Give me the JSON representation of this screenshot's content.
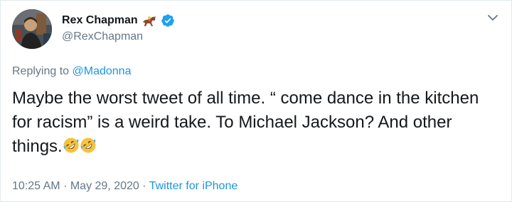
{
  "author": {
    "display_name": "Rex Chapman",
    "handle": "@RexChapman",
    "badges": [
      "horse-racing-emoji",
      "verified-badge"
    ]
  },
  "reply": {
    "prefix": "Replying to",
    "mention": "@Madonna"
  },
  "tweet": {
    "text": "Maybe the worst tweet of all time. “ come dance in the kitchen for racism” is a weird take. To Michael Jackson? And other things.",
    "emojis": [
      "rolling-on-floor-laughing",
      "rolling-on-floor-laughing"
    ]
  },
  "meta": {
    "time": "10:25 AM",
    "sep1": "·",
    "date": "May 29, 2020",
    "sep2": "·",
    "source": "Twitter for iPhone"
  },
  "colors": {
    "text": "#14171a",
    "secondary": "#657786",
    "link": "#1b95e0",
    "verified": "#1da1f2",
    "border": "#e1e8ed"
  }
}
